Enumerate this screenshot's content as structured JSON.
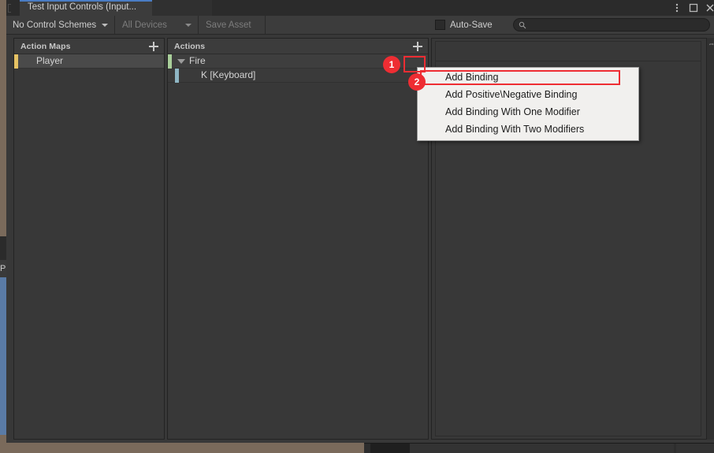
{
  "window": {
    "tab_title": "Test Input Controls (Input...",
    "controls": {
      "kebab": "more-options",
      "maximize": "maximize",
      "close": "close"
    }
  },
  "toolbar": {
    "control_schemes_label": "No Control Schemes",
    "devices_label": "All Devices",
    "save_asset_label": "Save Asset",
    "auto_save_label": "Auto-Save",
    "auto_save_checked": false,
    "search_value": "",
    "search_placeholder": ""
  },
  "panels": {
    "action_maps": {
      "header": "Action Maps",
      "add_tooltip": "+",
      "items": [
        {
          "label": "Player",
          "accent": "#e6c264",
          "selected": true
        }
      ]
    },
    "actions": {
      "header": "Actions",
      "add_tooltip": "+",
      "items": [
        {
          "label": "Fire",
          "accent": "#a9cf9a",
          "expanded": true,
          "type": "action"
        },
        {
          "label": "K [Keyboard]",
          "accent": "#8fb6c4",
          "type": "binding"
        }
      ]
    },
    "properties": {
      "header": "",
      "content": ""
    },
    "right_sliver_label": "t"
  },
  "context_menu": {
    "items": [
      "Add Binding",
      "Add Positive\\Negative Binding",
      "Add Binding With One Modifier",
      "Add Binding With Two Modifiers"
    ],
    "highlighted_index": 0
  },
  "annotations": {
    "color": "#ee2d33",
    "markers": [
      {
        "number": "1",
        "target": "add-binding-plus-button"
      },
      {
        "number": "2",
        "target": "context-menu-add-binding"
      }
    ]
  },
  "background": {
    "left_label": "P"
  }
}
